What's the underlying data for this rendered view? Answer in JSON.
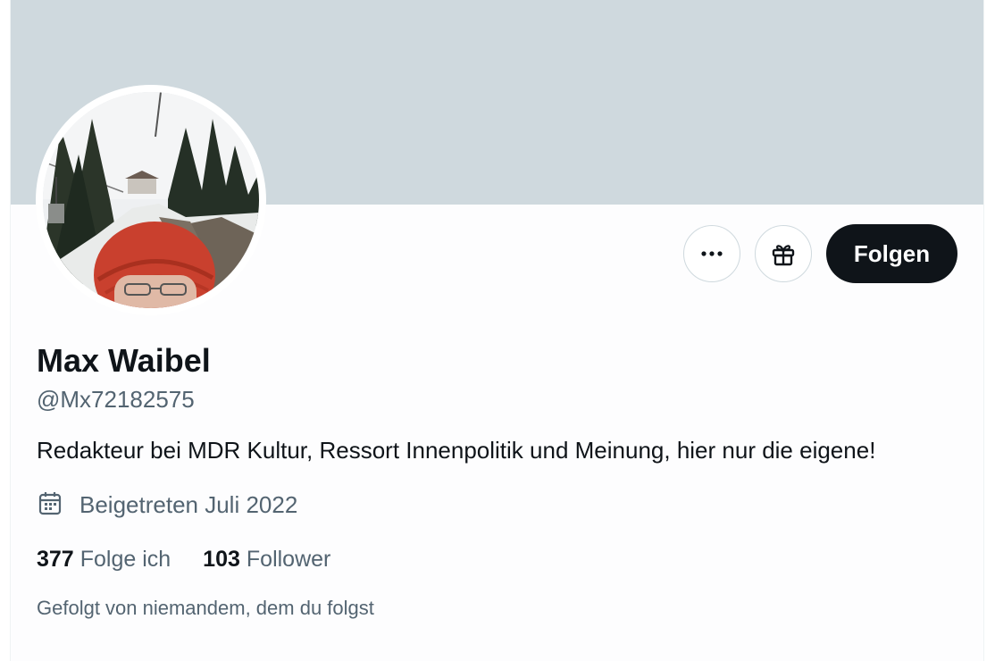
{
  "profile": {
    "name": "Max Waibel",
    "handle": "@Mx72182575",
    "bio": "Redakteur bei MDR Kultur, Ressort Innenpolitik und Meinung, hier nur die eigene!",
    "joined": "Beigetreten Juli 2022",
    "following_count": "377",
    "following_label": "Folge ich",
    "followers_count": "103",
    "followers_label": "Follower",
    "followed_by": "Gefolgt von niemandem, dem du folgst"
  },
  "actions": {
    "more_icon": "more-horizontal-icon",
    "gift_icon": "gift-icon",
    "follow_label": "Folgen"
  },
  "icons": {
    "joined": "calendar-icon"
  },
  "colors": {
    "banner": "#cfd9de",
    "primary_text": "#0f1419",
    "secondary_text": "#536471",
    "follow_button_bg": "#0f1419"
  }
}
